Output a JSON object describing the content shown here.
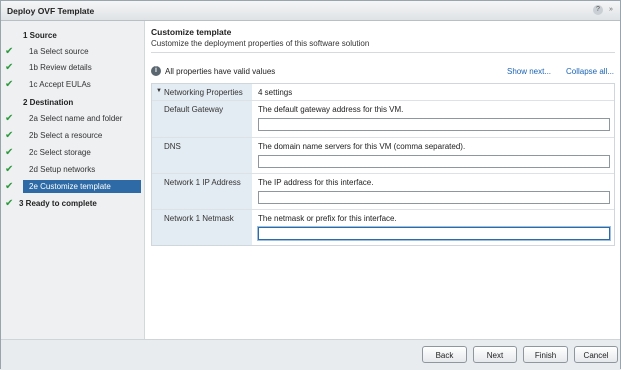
{
  "window": {
    "title": "Deploy OVF Template",
    "help_glyph": "?",
    "expand_glyph": "»"
  },
  "sidebar": {
    "steps": [
      {
        "label": "1  Source",
        "group": true,
        "done": false,
        "selected": false
      },
      {
        "label": "1a  Select source",
        "group": false,
        "done": true,
        "selected": false
      },
      {
        "label": "1b  Review details",
        "group": false,
        "done": true,
        "selected": false
      },
      {
        "label": "1c  Accept EULAs",
        "group": false,
        "done": true,
        "selected": false
      },
      {
        "label": "2  Destination",
        "group": true,
        "done": false,
        "selected": false
      },
      {
        "label": "2a  Select name and folder",
        "group": false,
        "done": true,
        "selected": false
      },
      {
        "label": "2b  Select a resource",
        "group": false,
        "done": true,
        "selected": false
      },
      {
        "label": "2c  Select storage",
        "group": false,
        "done": true,
        "selected": false
      },
      {
        "label": "2d  Setup networks",
        "group": false,
        "done": true,
        "selected": false
      },
      {
        "label": "2e  Customize template",
        "group": false,
        "done": true,
        "selected": true
      },
      {
        "label": "3  Ready to complete",
        "group": true,
        "done": true,
        "selected": false
      }
    ],
    "check_glyph": "✔"
  },
  "main": {
    "title": "Customize template",
    "subtitle": "Customize the deployment properties of this software solution",
    "info_text": "All properties have valid values",
    "info_glyph": "i",
    "show_next": "Show next...",
    "collapse_all": "Collapse all...",
    "group": {
      "name": "Networking Properties",
      "count": "4 settings",
      "caret": "▼"
    },
    "properties": [
      {
        "name": "Default Gateway",
        "description": "The default gateway address for this VM.",
        "value": ""
      },
      {
        "name": "DNS",
        "description": "The domain name servers for this VM (comma separated).",
        "value": ""
      },
      {
        "name": "Network 1 IP Address",
        "description": "The IP address for this interface.",
        "value": ""
      },
      {
        "name": "Network 1 Netmask",
        "description": "The netmask or prefix for this interface.",
        "value": ""
      }
    ]
  },
  "footer": {
    "back": "Back",
    "next": "Next",
    "finish": "Finish",
    "cancel": "Cancel"
  }
}
